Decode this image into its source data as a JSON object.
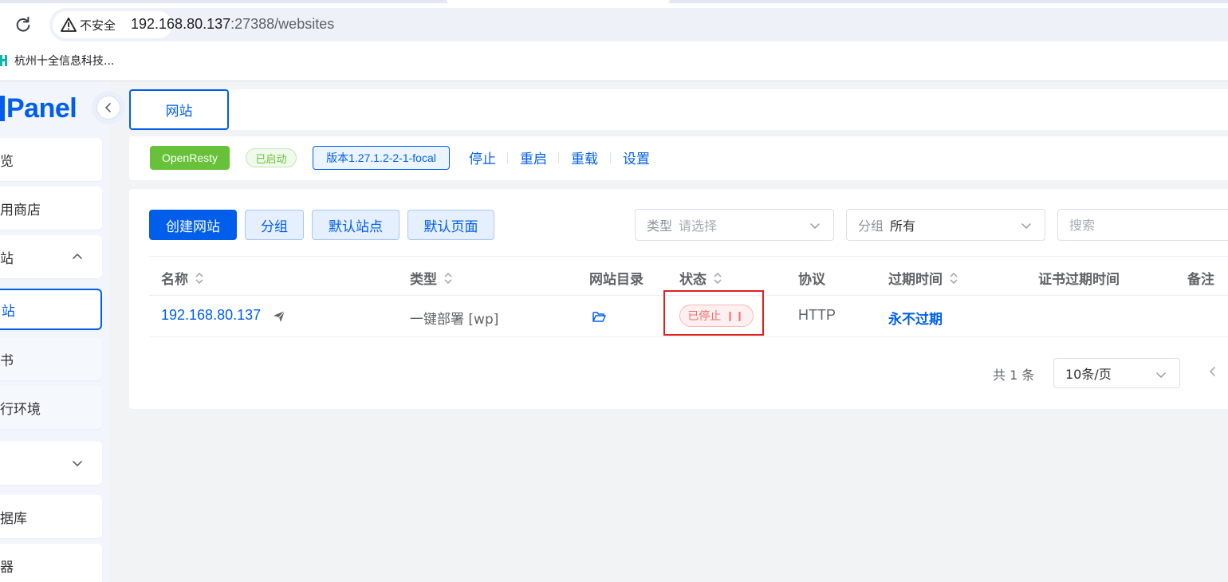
{
  "browser": {
    "security_label": "不安全",
    "url_host": "192.168.80.137",
    "url_rest": ":27388/websites",
    "bookmark_label": "杭州十全信息科技..."
  },
  "sidebar": {
    "logo_text": "Panel",
    "items": [
      {
        "label": "览"
      },
      {
        "label": "用商店"
      },
      {
        "label": "站"
      },
      {
        "label": "站"
      },
      {
        "label": "书"
      },
      {
        "label": "行环境"
      },
      {
        "label": ""
      },
      {
        "label": "据库"
      },
      {
        "label": "器"
      }
    ]
  },
  "tabs": {
    "active": "网站"
  },
  "server": {
    "name": "OpenResty",
    "state": "已启动",
    "version": "版本1.27.1.2-2-1-focal",
    "actions": [
      "停止",
      "重启",
      "重载",
      "设置"
    ]
  },
  "toolbar": {
    "create": "创建网站",
    "group": "分组",
    "default_site": "默认站点",
    "default_page": "默认页面",
    "type_filter": {
      "prefix": "类型",
      "placeholder": "请选择"
    },
    "group_filter": {
      "prefix": "分组",
      "value": "所有"
    },
    "search_placeholder": "搜索"
  },
  "table": {
    "columns": [
      "名称",
      "类型",
      "网站目录",
      "状态",
      "协议",
      "过期时间",
      "证书过期时间",
      "备注"
    ],
    "rows": [
      {
        "name": "192.168.80.137",
        "type": "一键部署 [wp]",
        "status": "已停止",
        "protocol": "HTTP",
        "expire": "永不过期"
      }
    ]
  },
  "pagination": {
    "total": "共 1 条",
    "page_size": "10条/页"
  },
  "colors": {
    "primary": "#005eeb",
    "success": "#67c23a",
    "danger": "#f56c6c",
    "highlight": "#e02020"
  }
}
